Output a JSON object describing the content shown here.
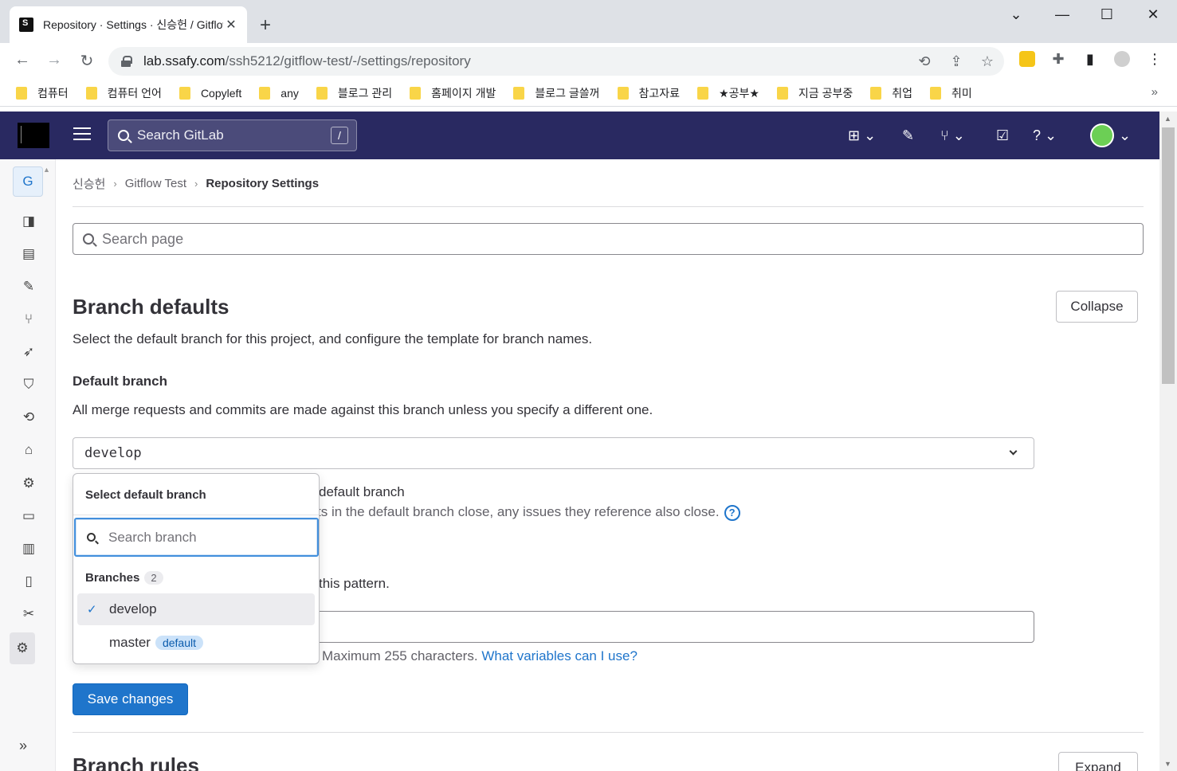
{
  "browser": {
    "tab_title": "Repository · Settings · 신승헌 / Gitflow Test",
    "url_host": "lab.ssafy.com",
    "url_path": "/ssh5212/gitflow-test/-/settings/repository",
    "new_tab": "+",
    "bookmarks": [
      "컴퓨터",
      "컴퓨터 언어",
      "Copyleft",
      "any",
      "블로그 관리",
      "홈페이지 개발",
      "블로그 글쓸꺼",
      "참고자료",
      "★공부★",
      "지금 공부중",
      "취업",
      "취미"
    ],
    "bookmarks_more": "»"
  },
  "header": {
    "search_placeholder": "Search GitLab",
    "search_shortcut": "/"
  },
  "sidebar": {
    "project_initial": "G"
  },
  "breadcrumb": {
    "items": [
      "신승헌",
      "Gitflow Test",
      "Repository Settings"
    ]
  },
  "page_search": {
    "placeholder": "Search page"
  },
  "branch_defaults": {
    "title": "Branch defaults",
    "collapse_label": "Collapse",
    "description": "Select the default branch for this project, and configure the template for branch names.",
    "default_branch_label": "Default branch",
    "default_branch_help": "All merge requests and commits are made against this branch unless you specify a different one.",
    "selected_branch": "develop",
    "autoclose_label": "default branch",
    "autoclose_help": "ts in the default branch close, any issues they reference also close.",
    "pattern_label": "this pattern.",
    "pattern_help": "Maximum 255 characters.",
    "pattern_help_link": "What variables can I use?",
    "save_label": "Save changes"
  },
  "branch_rules": {
    "title": "Branch rules",
    "expand_label": "Expand"
  },
  "dropdown": {
    "header": "Select default branch",
    "search_placeholder": "Search branch",
    "group_label": "Branches",
    "group_count": "2",
    "items": [
      {
        "name": "develop",
        "selected": true,
        "badge": ""
      },
      {
        "name": "master",
        "selected": false,
        "badge": "default"
      }
    ]
  },
  "colors": {
    "header_bg": "#292961",
    "primary": "#1f75cb",
    "badge_bg": "#cbe2f9"
  }
}
